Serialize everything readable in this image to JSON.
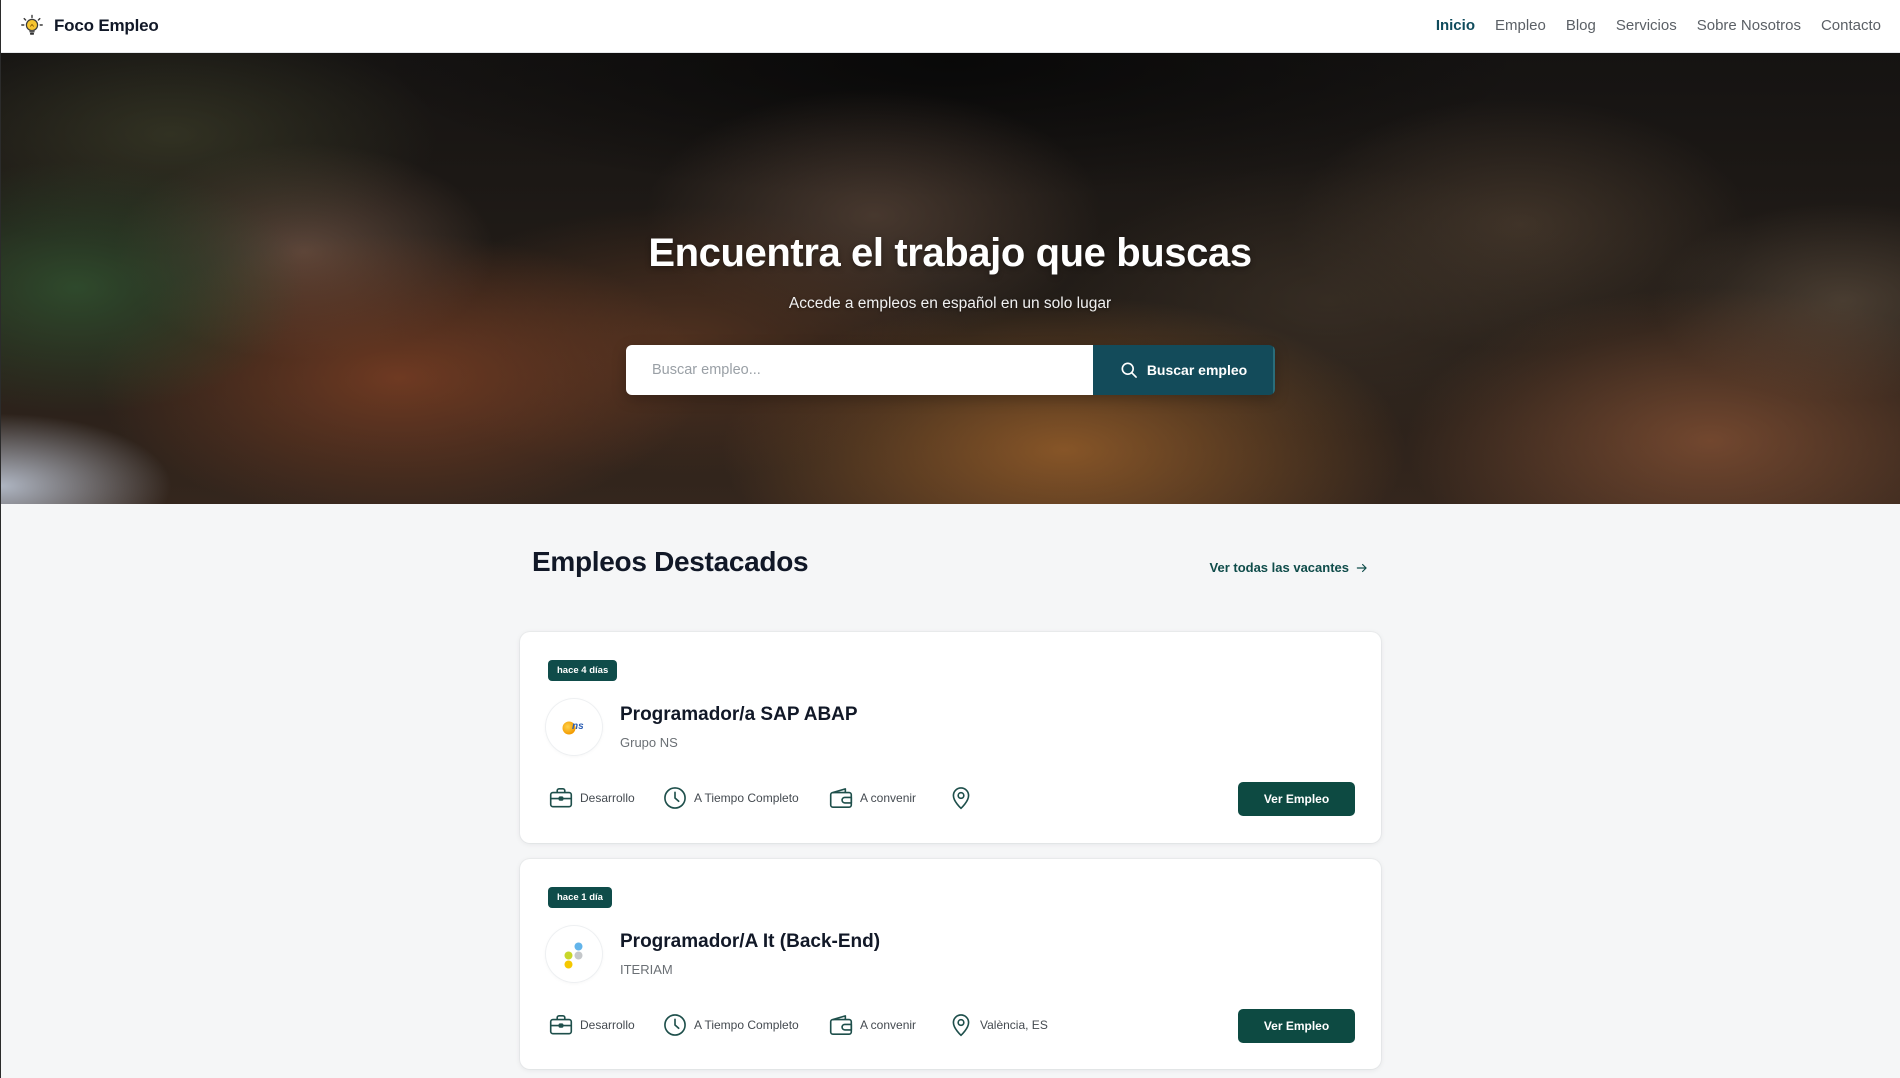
{
  "brand": {
    "name": "Foco Empleo",
    "logo_icon": "lightbulb-icon"
  },
  "nav": {
    "items": [
      {
        "label": "Inicio",
        "active": true
      },
      {
        "label": "Empleo",
        "active": false
      },
      {
        "label": "Blog",
        "active": false
      },
      {
        "label": "Servicios",
        "active": false
      },
      {
        "label": "Sobre Nosotros",
        "active": false
      },
      {
        "label": "Contacto",
        "active": false
      }
    ]
  },
  "hero": {
    "title": "Encuentra el trabajo que buscas",
    "subtitle": "Accede a empleos en español en un solo lugar",
    "search": {
      "placeholder": "Buscar empleo...",
      "value": "",
      "button_label": "Buscar empleo",
      "button_icon": "search-icon"
    }
  },
  "featured": {
    "title": "Empleos Destacados",
    "view_all_label": "Ver todas las vacantes",
    "view_all_icon": "arrow-right-icon",
    "jobs": [
      {
        "posted": "hace 4 días",
        "title": "Programador/a SAP ABAP",
        "company": "Grupo NS",
        "logo": "grupo-ns-logo",
        "logo_lettering": "ns",
        "category": "Desarrollo",
        "category_icon": "briefcase-icon",
        "schedule": "A Tiempo Completo",
        "schedule_icon": "clock-icon",
        "salary": "A convenir",
        "salary_icon": "wallet-icon",
        "location": "",
        "location_icon": "map-pin-icon",
        "button_label": "Ver Empleo"
      },
      {
        "posted": "hace 1 día",
        "title": "Programador/A It (Back-End)",
        "company": "ITERIAM",
        "logo": "iteriam-logo",
        "category": "Desarrollo",
        "category_icon": "briefcase-icon",
        "schedule": "A Tiempo Completo",
        "schedule_icon": "clock-icon",
        "salary": "A convenir",
        "salary_icon": "wallet-icon",
        "location": "València, ES",
        "location_icon": "map-pin-icon",
        "button_label": "Ver Empleo"
      }
    ]
  },
  "colors": {
    "primary": "#0f4c4a",
    "search_button": "#134b5a",
    "nav_active": "#0f4b5c",
    "page_background": "#f5f6f7"
  }
}
